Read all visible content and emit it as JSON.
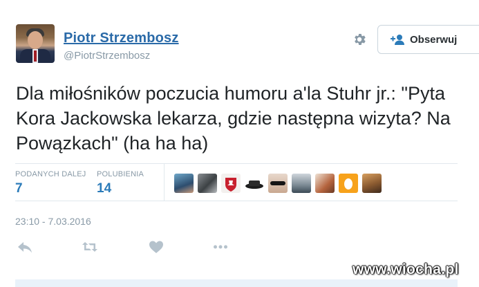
{
  "author": {
    "name": "Piotr Strzembosz",
    "handle": "@PiotrStrzembosz"
  },
  "follow_button": {
    "label": "Obserwuj"
  },
  "tweet": {
    "text": "Dla miłośników poczucia humoru a'la Stuhr jr.: \"Pyta Kora Jackowska lekarza, gdzie następna wizyta? Na Powązkach\" (ha ha ha)"
  },
  "stats": {
    "retweets_label": "PODANYCH DALEJ",
    "retweets_value": "7",
    "likes_label": "POLUBIENIA",
    "likes_value": "14"
  },
  "likers": [
    "avatar-1",
    "avatar-2",
    "avatar-3",
    "avatar-4",
    "avatar-5",
    "avatar-6",
    "avatar-7",
    "avatar-8",
    "avatar-9"
  ],
  "timestamp": "23:10 - 7.03.2016",
  "actions": [
    "reply-icon",
    "retweet-icon",
    "like-icon",
    "more-icon"
  ],
  "colors": {
    "link": "#2a6aa8",
    "stat_value": "#2b7bb9",
    "muted": "#8899a6",
    "divider": "#e1e8ed",
    "icon": "#b5c2cc"
  },
  "watermark": "www.wiocha.pl"
}
